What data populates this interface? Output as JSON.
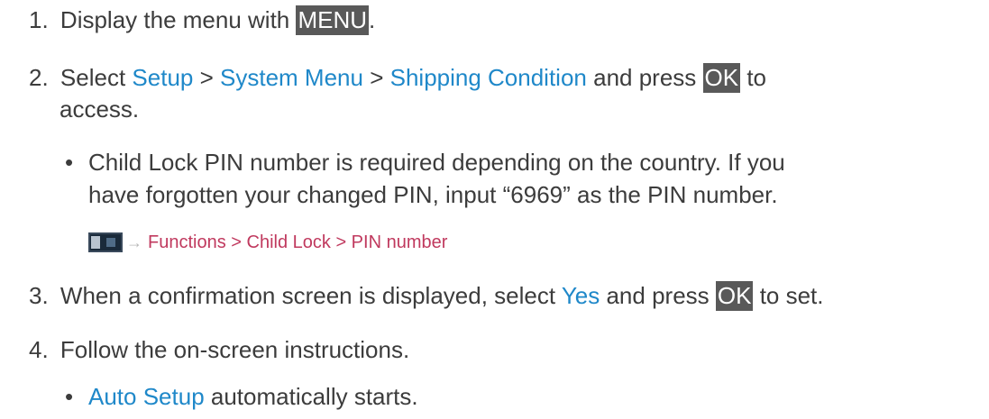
{
  "steps": {
    "s1": {
      "num": "1.",
      "text1": "Display the menu with ",
      "key": "MENU",
      "text2": "."
    },
    "s2": {
      "num": "2.",
      "text1": "Select ",
      "link1": "Setup",
      "sep1": " > ",
      "link2": "System Menu",
      "sep2": " > ",
      "link3": "Shipping Condition",
      "text2": " and press ",
      "key": "OK",
      "text3": " to",
      "cont": "access."
    },
    "note1": {
      "bullet": "•",
      "line1": "Child Lock PIN number is required depending on the country. If you",
      "line2": "have forgotten your changed PIN, input “6969” as the PIN number."
    },
    "reference": {
      "arrow": "→",
      "text": "Functions > Child Lock > PIN number"
    },
    "s3": {
      "num": "3.",
      "text1": "When a confirmation screen is displayed, select ",
      "link": "Yes",
      "text2": " and press ",
      "key": "OK",
      "text3": " to set."
    },
    "s4": {
      "num": "4.",
      "text": "Follow the on-screen instructions."
    },
    "note2": {
      "bullet": "•",
      "link": "Auto Setup",
      "text": " automatically starts."
    }
  },
  "colors": {
    "link": "#1f88c9",
    "reference": "#c0395e",
    "key_bg": "#595959",
    "body_text": "#3c3c3c"
  },
  "icons": [
    "tv-menu-icon",
    "arrow-right-icon"
  ]
}
